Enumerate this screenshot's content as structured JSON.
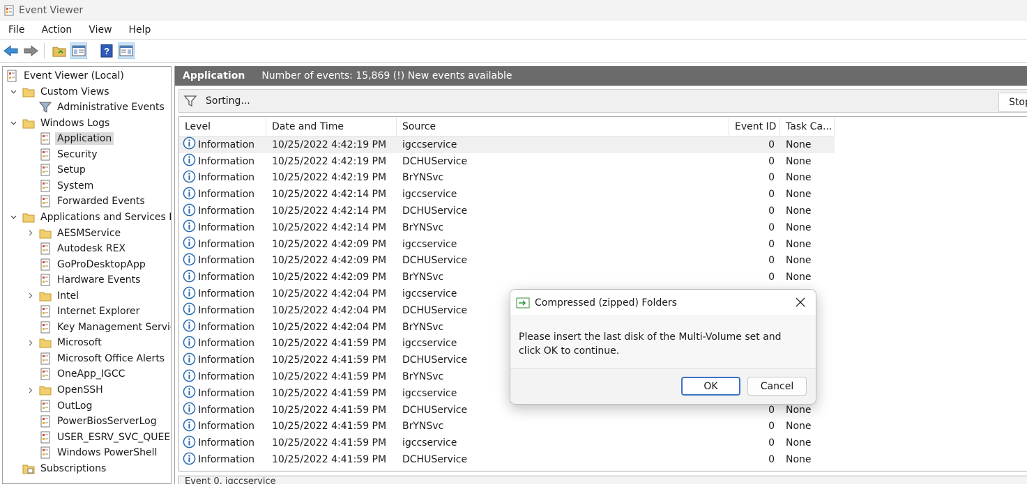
{
  "window": {
    "title": "Event Viewer"
  },
  "menu": [
    "File",
    "Action",
    "View",
    "Help"
  ],
  "toolbar": {
    "icons": [
      "back-arrow-icon",
      "forward-arrow-icon",
      "open-folder-icon",
      "console-tree-icon",
      "help-icon",
      "action-pane-icon"
    ]
  },
  "tree": {
    "items": [
      {
        "label": "Event Viewer (Local)",
        "icon": "event-viewer-icon"
      },
      {
        "label": "Custom Views",
        "icon": "folder-icon",
        "expander": "v"
      },
      {
        "label": "Administrative Events",
        "icon": "filter-icon"
      },
      {
        "label": "Windows Logs",
        "icon": "folder-icon",
        "expander": "v"
      },
      {
        "label": "Application",
        "icon": "log-icon",
        "selected": true
      },
      {
        "label": "Security",
        "icon": "log-icon"
      },
      {
        "label": "Setup",
        "icon": "log-icon"
      },
      {
        "label": "System",
        "icon": "log-icon"
      },
      {
        "label": "Forwarded Events",
        "icon": "log-icon"
      },
      {
        "label": "Applications and Services Logs",
        "icon": "folder-icon",
        "expander": "v"
      },
      {
        "label": "AESMService",
        "icon": "folder-icon",
        "expander": ">"
      },
      {
        "label": "Autodesk REX",
        "icon": "log-icon"
      },
      {
        "label": "GoProDesktopApp",
        "icon": "log-icon"
      },
      {
        "label": "Hardware Events",
        "icon": "log-icon"
      },
      {
        "label": "Intel",
        "icon": "folder-icon",
        "expander": ">"
      },
      {
        "label": "Internet Explorer",
        "icon": "log-icon"
      },
      {
        "label": "Key Management Service",
        "icon": "log-icon"
      },
      {
        "label": "Microsoft",
        "icon": "folder-icon",
        "expander": ">"
      },
      {
        "label": "Microsoft Office Alerts",
        "icon": "log-icon"
      },
      {
        "label": "OneApp_IGCC",
        "icon": "log-icon"
      },
      {
        "label": "OpenSSH",
        "icon": "folder-icon",
        "expander": ">"
      },
      {
        "label": "OutLog",
        "icon": "log-icon"
      },
      {
        "label": "PowerBiosServerLog",
        "icon": "log-icon"
      },
      {
        "label": "USER_ESRV_SVC_QUEENCREEK",
        "icon": "log-icon"
      },
      {
        "label": "Windows PowerShell",
        "icon": "log-icon"
      },
      {
        "label": "Subscriptions",
        "icon": "subscriptions-icon"
      }
    ]
  },
  "main": {
    "log_name": "Application",
    "status": "Number of events: 15,869 (!) New events available",
    "filter_text": "Sorting...",
    "stop_label": "Stop",
    "columns": [
      "Level",
      "Date and Time",
      "Source",
      "Event ID",
      "Task Ca..."
    ],
    "rows": [
      [
        "Information",
        "10/25/2022 4:42:19 PM",
        "igccservice",
        "0",
        "None"
      ],
      [
        "Information",
        "10/25/2022 4:42:19 PM",
        "DCHUService",
        "0",
        "None"
      ],
      [
        "Information",
        "10/25/2022 4:42:19 PM",
        "BrYNSvc",
        "0",
        "None"
      ],
      [
        "Information",
        "10/25/2022 4:42:14 PM",
        "igccservice",
        "0",
        "None"
      ],
      [
        "Information",
        "10/25/2022 4:42:14 PM",
        "DCHUService",
        "0",
        "None"
      ],
      [
        "Information",
        "10/25/2022 4:42:14 PM",
        "BrYNSvc",
        "0",
        "None"
      ],
      [
        "Information",
        "10/25/2022 4:42:09 PM",
        "igccservice",
        "0",
        "None"
      ],
      [
        "Information",
        "10/25/2022 4:42:09 PM",
        "DCHUService",
        "0",
        "None"
      ],
      [
        "Information",
        "10/25/2022 4:42:09 PM",
        "BrYNSvc",
        "0",
        "None"
      ],
      [
        "Information",
        "10/25/2022 4:42:04 PM",
        "igccservice",
        "",
        ""
      ],
      [
        "Information",
        "10/25/2022 4:42:04 PM",
        "DCHUService",
        "",
        ""
      ],
      [
        "Information",
        "10/25/2022 4:42:04 PM",
        "BrYNSvc",
        "",
        ""
      ],
      [
        "Information",
        "10/25/2022 4:41:59 PM",
        "igccservice",
        "",
        ""
      ],
      [
        "Information",
        "10/25/2022 4:41:59 PM",
        "DCHUService",
        "",
        ""
      ],
      [
        "Information",
        "10/25/2022 4:41:59 PM",
        "BrYNSvc",
        "",
        ""
      ],
      [
        "Information",
        "10/25/2022 4:41:59 PM",
        "igccservice",
        "",
        ""
      ],
      [
        "Information",
        "10/25/2022 4:41:59 PM",
        "DCHUService",
        "0",
        "None"
      ],
      [
        "Information",
        "10/25/2022 4:41:59 PM",
        "BrYNSvc",
        "0",
        "None"
      ],
      [
        "Information",
        "10/25/2022 4:41:59 PM",
        "igccservice",
        "0",
        "None"
      ],
      [
        "Information",
        "10/25/2022 4:41:59 PM",
        "DCHUService",
        "0",
        "None"
      ]
    ]
  },
  "bottom_panel": {
    "title": "Event 0, igccservice"
  },
  "dialog": {
    "title": "Compressed (zipped) Folders",
    "message_line1": "Please insert the last disk of the Multi-Volume set and",
    "message_line2": "click OK to continue.",
    "ok_label": "OK",
    "cancel_label": "Cancel"
  },
  "colors": {
    "header_bg": "#6b6b6b",
    "selection": "#d9d9d9",
    "info_blue": "#2b6cb5",
    "dialog_button_border": "#3b73c4"
  }
}
